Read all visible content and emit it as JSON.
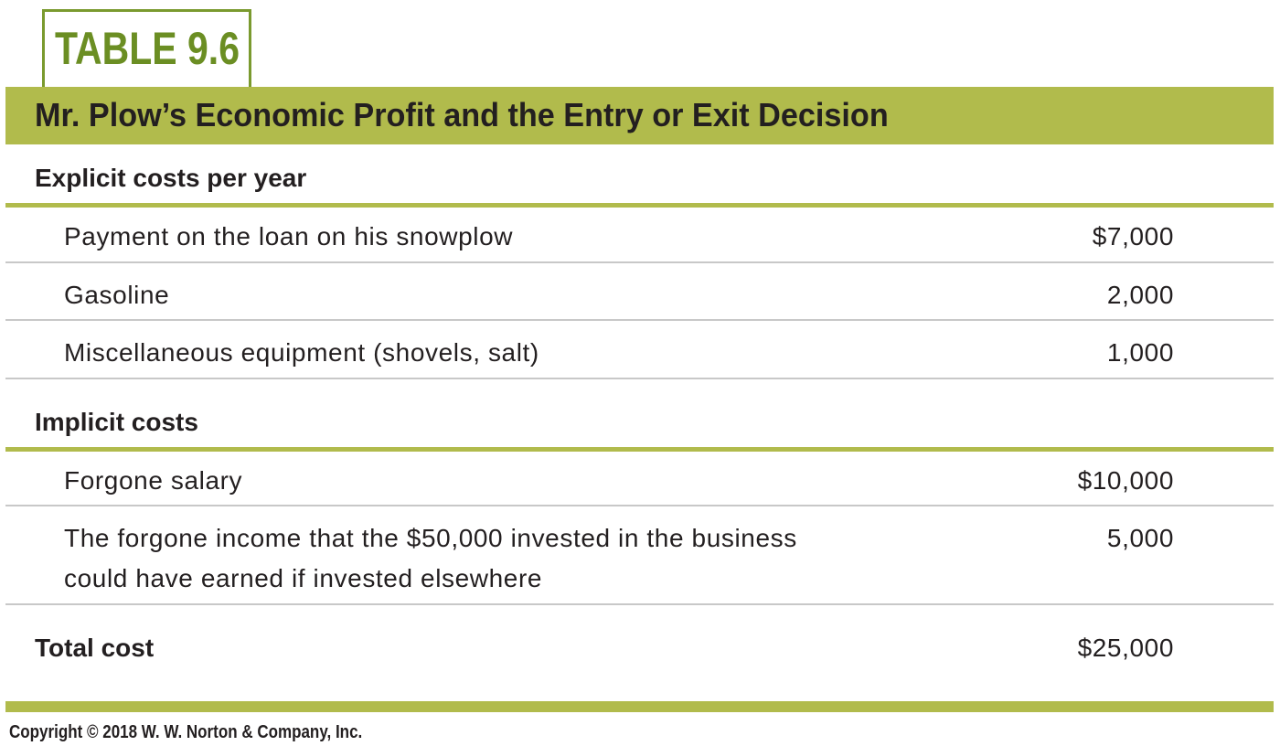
{
  "table": {
    "label": "TABLE 9.6",
    "title": "Mr. Plow’s Economic Profit and the Entry or Exit Decision",
    "sections": [
      {
        "heading": "Explicit costs per year",
        "rows": [
          {
            "label": "Payment on the loan on his snowplow",
            "value": "$7,000"
          },
          {
            "label": "Gasoline",
            "value": "2,000"
          },
          {
            "label": "Miscellaneous equipment (shovels, salt)",
            "value": "1,000"
          }
        ]
      },
      {
        "heading": "Implicit costs",
        "rows": [
          {
            "label": "Forgone salary",
            "value": "$10,000"
          },
          {
            "label_line1": "The forgone income that the $50,000 invested in the business",
            "label_line2": "could have earned if invested elsewhere",
            "value": "5,000"
          }
        ]
      }
    ],
    "total": {
      "label": "Total cost",
      "value": "$25,000"
    },
    "copyright": "Copyright © 2018 W. W. Norton & Company, Inc."
  },
  "colors": {
    "accent": "#b1bb4c",
    "label_green": "#6b8e23",
    "text": "#231f20",
    "rule": "#c8c8c8"
  }
}
